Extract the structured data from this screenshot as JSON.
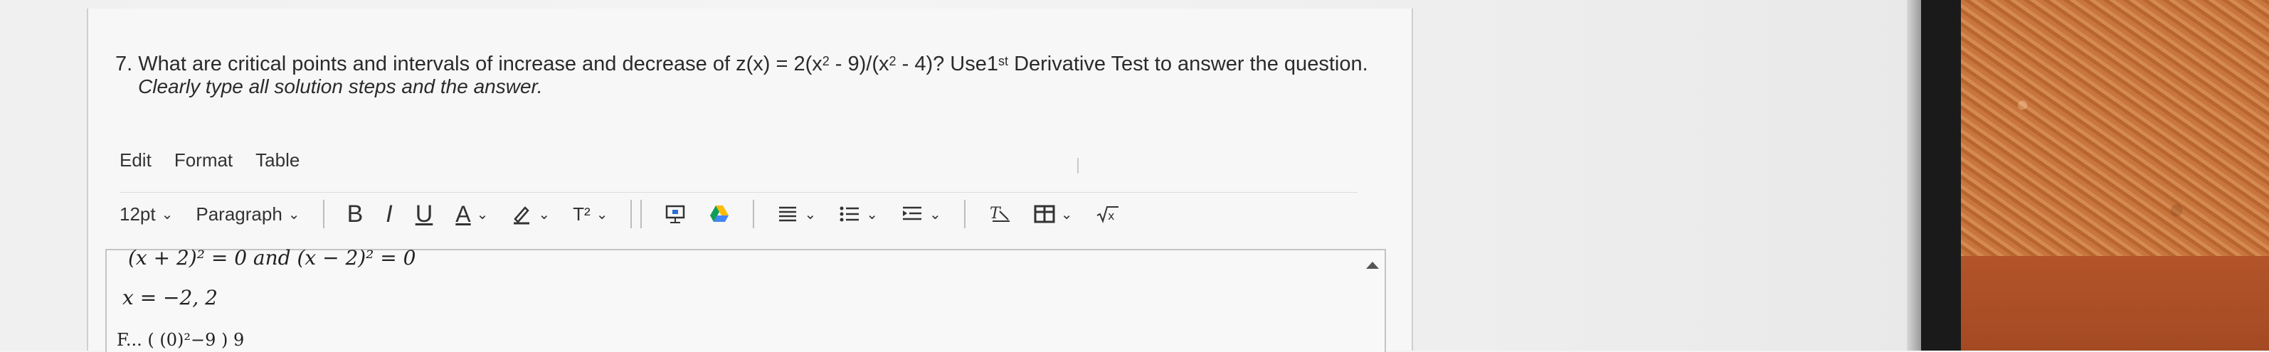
{
  "question": {
    "number": "7.",
    "text_before_sup": "What are critical points and intervals of increase and decrease of z(x) = 2(x",
    "sup1": "2",
    "text_mid": " - 9)/(x",
    "sup2": "2",
    "text_mid2": " - 4)? Use1",
    "sup3": "st",
    "text_after": " Derivative Test to answer the question.",
    "instruction": "Clearly type all solution steps and the answer."
  },
  "menubar": [
    "Edit",
    "Format",
    "Table"
  ],
  "toolbar": {
    "font_size": "12pt",
    "block_format": "Paragraph",
    "bold": "B",
    "italic": "I",
    "underline": "U",
    "text_color": "A",
    "superscript": "T²"
  },
  "editor": {
    "line1": "(x + 2)² = 0 and (x − 2)² = 0",
    "line2": "x = −2, 2",
    "line3_partial": "F...  ( (0)²−9 )     9"
  }
}
